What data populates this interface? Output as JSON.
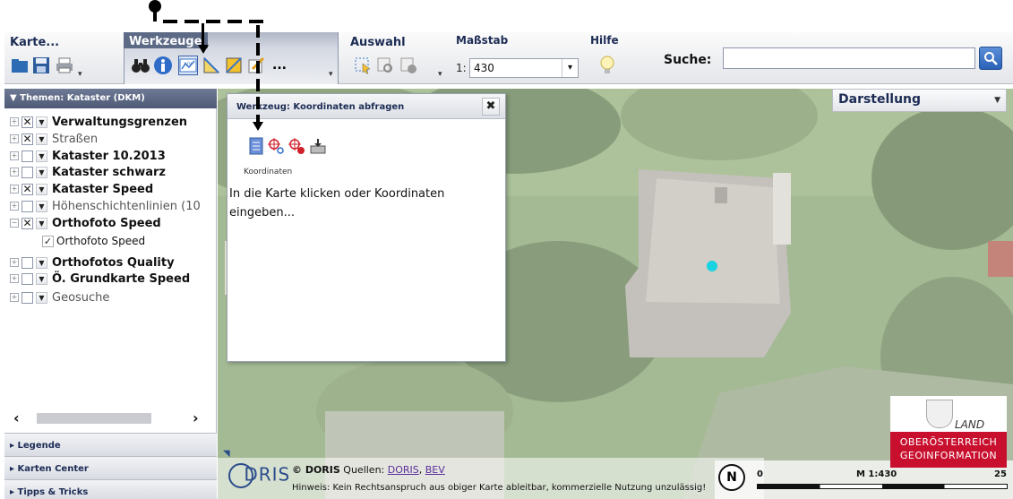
{
  "toolbar": {
    "groups": {
      "karte": "Karte...",
      "werkzeug": "Werkzeuge",
      "auswahl": "Auswahl",
      "massstab": "Maßstab",
      "hilfe": "Hilfe"
    },
    "scale_prefix": "1:",
    "scale_value": "430",
    "search_label": "Suche:",
    "search_value": "",
    "more_tools": "..."
  },
  "left_panel": {
    "header": "▼ Themen: Kataster (DKM)",
    "layers": [
      {
        "label": "Verwaltungsgrenzen",
        "checked": "✕",
        "bold": true,
        "expander": "+"
      },
      {
        "label": "Straßen",
        "checked": "✕",
        "bold": false,
        "expander": "+"
      },
      {
        "label": "Kataster 10.2013",
        "checked": "",
        "bold": true,
        "expander": "+"
      },
      {
        "label": "Kataster schwarz",
        "checked": "",
        "bold": true,
        "expander": "+"
      },
      {
        "label": "Kataster Speed",
        "checked": "✕",
        "bold": true,
        "expander": "+"
      },
      {
        "label": "Höhenschichtenlinien (10",
        "checked": "",
        "bold": false,
        "expander": "+"
      },
      {
        "label": "Orthofoto Speed",
        "checked": "✕",
        "bold": true,
        "expander": "−"
      },
      {
        "label": "Orthofotos Quality",
        "checked": "",
        "bold": true,
        "expander": "+"
      },
      {
        "label": "Ö. Grundkarte Speed",
        "checked": "",
        "bold": true,
        "expander": "+"
      },
      {
        "label": "Geosuche",
        "checked": "",
        "bold": false,
        "expander": "+"
      }
    ],
    "sublayer": {
      "label": "Orthofoto Speed",
      "checked": "✓"
    },
    "scroll_left": "‹",
    "scroll_right": "›",
    "accordion": [
      "▸ Legende",
      "▸ Karten Center",
      "▸ Tipps & Tricks"
    ]
  },
  "map": {
    "darstellung": "Darstellung",
    "marker_color": "#19d3e0"
  },
  "tool_dialog": {
    "title": "Werkzeug: Koordinaten abfragen",
    "close": "✖",
    "caption": "Koordinaten",
    "text": "In die Karte klicken oder Koordinaten eingeben..."
  },
  "footer": {
    "logo": "DRIS",
    "copyright_prefix": "© DORIS",
    "sources_label": "Quellen:",
    "source_1": "DORIS",
    "source_sep": ",",
    "source_2": "BEV",
    "hinweis": "Hinweis: Kein Rechtsanspruch aus obiger Karte ableitbar, kommerzielle Nutzung unzulässig!",
    "scale_start": "0",
    "scale_text": "M 1:430",
    "scale_end": "25",
    "north": "N"
  },
  "land_logo": {
    "land": "LAND",
    "line1": "OBERÖSTERREICH",
    "line2": "GEOINFORMATION"
  }
}
